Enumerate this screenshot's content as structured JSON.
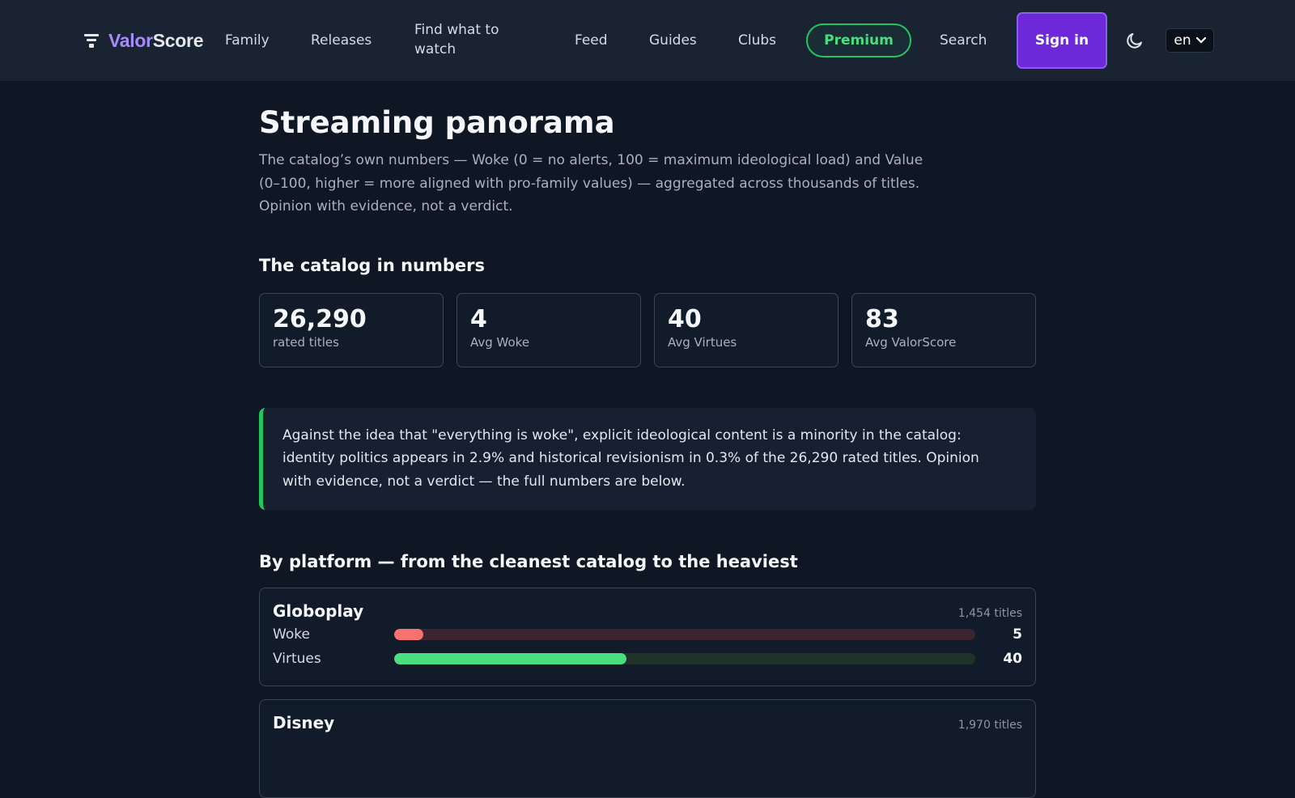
{
  "brand": {
    "part1": "Valor",
    "part2": "Score"
  },
  "nav": {
    "links": [
      "Family",
      "Releases",
      "Find what to watch",
      "Feed",
      "Guides",
      "Clubs"
    ],
    "premium": "Premium",
    "search": "Search",
    "signin": "Sign in",
    "language": "en"
  },
  "page": {
    "title": "Streaming panorama",
    "intro": "The catalog’s own numbers — Woke (0 = no alerts, 100 = maximum ideological load) and Value (0–100, higher = more aligned with pro-family values) — aggregated across thousands of titles. Opinion with evidence, not a verdict."
  },
  "catalog": {
    "heading": "The catalog in numbers",
    "stats": [
      {
        "value": "26,290",
        "label": "rated titles"
      },
      {
        "value": "4",
        "label": "Avg Woke"
      },
      {
        "value": "40",
        "label": "Avg Virtues"
      },
      {
        "value": "83",
        "label": "Avg ValorScore"
      }
    ]
  },
  "callout": "Against the idea that \"everything is woke\", explicit ideological content is a minority in the catalog: identity politics appears in 2.9% and historical revisionism in 0.3% of the 26,290 rated titles. Opinion with evidence, not a verdict — the full numbers are below.",
  "platforms": {
    "heading": "By platform — from the cleanest catalog to the heaviest",
    "items": [
      {
        "name": "Globoplay",
        "count": "1,454 titles",
        "woke_label": "Woke",
        "woke": 5,
        "virtues_label": "Virtues",
        "virtues": 40
      },
      {
        "name": "Disney",
        "count": "1,970 titles"
      }
    ]
  },
  "colors": {
    "accent": "#6d28d9",
    "premium": "#22c55e",
    "woke_bar": "#f87171",
    "virtues_bar": "#4ade80",
    "background": "#0f1724"
  }
}
